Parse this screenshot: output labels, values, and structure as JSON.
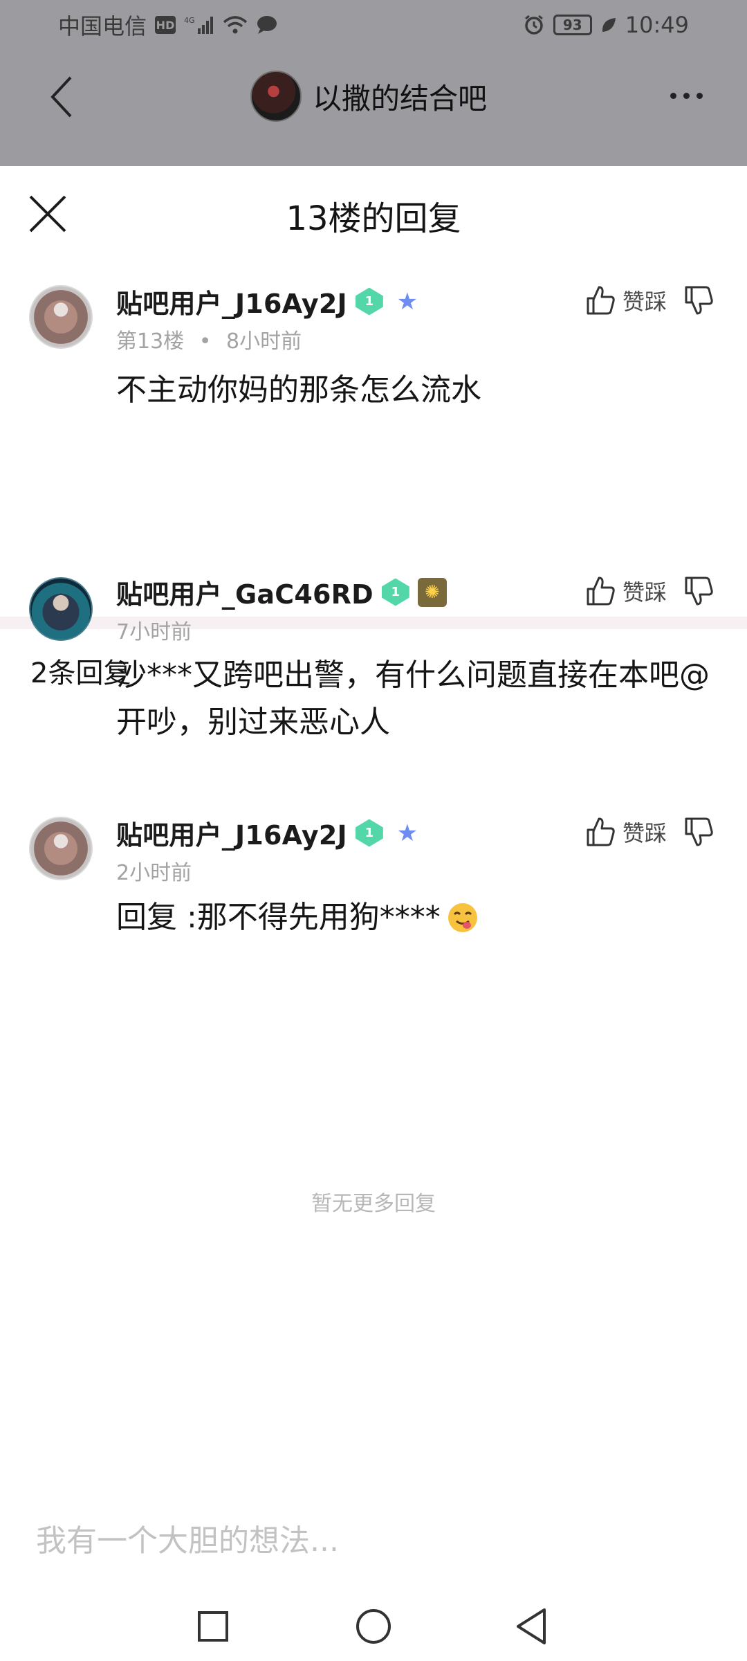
{
  "status_bar": {
    "carrier": "中国电信",
    "hd": "HD",
    "network": "4G",
    "battery": "93",
    "time": "10:49"
  },
  "top_bar": {
    "forum_title": "以撒的结合吧"
  },
  "sheet": {
    "title": "13楼的回复"
  },
  "main_post": {
    "username": "贴吧用户_J16Ay2J",
    "level": "1",
    "floor": "第13楼",
    "dot": "•",
    "time": "8小时前",
    "content": "不主动你妈的那条怎么流水",
    "like_label": "赞踩"
  },
  "replies_header": "2条回复",
  "replies": [
    {
      "username": "贴吧用户_GaC46RD",
      "level": "1",
      "time": "7小时前",
      "content": "沙***又跨吧出警，有什么问题直接在本吧@开吵，别过来恶心人",
      "like_label": "赞踩"
    },
    {
      "username": "贴吧用户_J16Ay2J",
      "level": "1",
      "time": "2小时前",
      "content": "回复 :那不得先用狗****",
      "like_label": "赞踩"
    }
  ],
  "no_more_text": "暂无更多回复",
  "input_placeholder": "我有一个大胆的想法..."
}
